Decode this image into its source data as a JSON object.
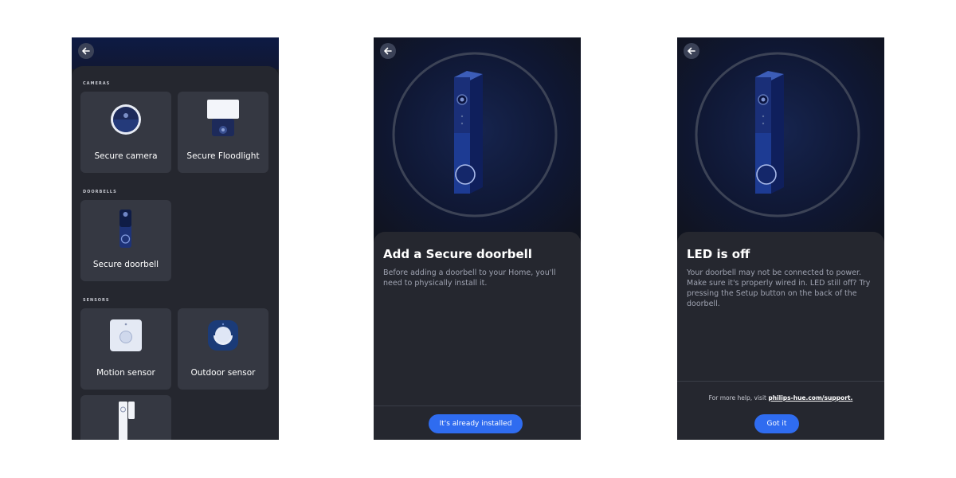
{
  "screen1": {
    "sections": [
      {
        "title": "CAMERAS",
        "items": [
          {
            "label": "Secure camera",
            "icon": "camera-icon"
          },
          {
            "label": "Secure Floodlight",
            "icon": "floodlight-icon"
          }
        ]
      },
      {
        "title": "DOORBELLS",
        "items": [
          {
            "label": "Secure doorbell",
            "icon": "doorbell-icon"
          }
        ]
      },
      {
        "title": "SENSORS",
        "items": [
          {
            "label": "Motion sensor",
            "icon": "motion-sensor-icon"
          },
          {
            "label": "Outdoor sensor",
            "icon": "outdoor-sensor-icon"
          },
          {
            "label": "",
            "icon": "contact-sensor-icon"
          }
        ]
      }
    ]
  },
  "screen2": {
    "title": "Add a Secure doorbell",
    "body": "Before adding a doorbell to your Home, you'll need to physically install it.",
    "button": "It's already installed"
  },
  "screen3": {
    "title": "LED is off",
    "body": "Your doorbell may not be connected to power. Make sure it's properly wired in. LED still off? Try pressing the Setup button on the back of the doorbell.",
    "help_prefix": "For more help, visit ",
    "help_link": "philips-hue.com/support.",
    "button": "Got it"
  },
  "colors": {
    "accent": "#2f6cf0",
    "background": "#1b1d24",
    "card": "#353842"
  }
}
